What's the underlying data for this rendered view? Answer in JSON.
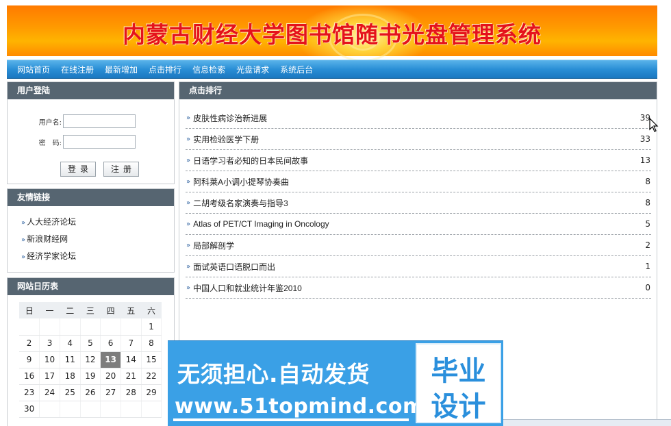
{
  "banner": {
    "title": "内蒙古财经大学图书馆随书光盘管理系统"
  },
  "nav": {
    "items": [
      "网站首页",
      "在线注册",
      "最新增加",
      "点击排行",
      "信息检索",
      "光盘请求",
      "系统后台"
    ]
  },
  "login": {
    "title": "用户登陆",
    "username_label": "用户名:",
    "password_label": "密　码:",
    "username_value": "",
    "password_value": "",
    "login_button": "登录",
    "register_button": "注册"
  },
  "links": {
    "title": "友情链接",
    "items": [
      "人大经济论坛",
      "新浪财经网",
      "经济学家论坛"
    ]
  },
  "calendar": {
    "title": "网站日历表",
    "weekdays": [
      "日",
      "一",
      "二",
      "三",
      "四",
      "五",
      "六"
    ],
    "weeks": [
      [
        "",
        "",
        "",
        "",
        "",
        "",
        "1"
      ],
      [
        "2",
        "3",
        "4",
        "5",
        "6",
        "7",
        "8"
      ],
      [
        "9",
        "10",
        "11",
        "12",
        "13",
        "14",
        "15"
      ],
      [
        "16",
        "17",
        "18",
        "19",
        "20",
        "21",
        "22"
      ],
      [
        "23",
        "24",
        "25",
        "26",
        "27",
        "28",
        "29"
      ],
      [
        "30",
        "",
        "",
        "",
        "",
        "",
        ""
      ]
    ],
    "today": "13"
  },
  "ranking": {
    "title": "点击排行",
    "items": [
      {
        "title": "皮肤性病诊治新进展",
        "count": "39"
      },
      {
        "title": "实用检验医学下册",
        "count": "33"
      },
      {
        "title": "日语学习者必知的日本民间故事",
        "count": "13"
      },
      {
        "title": "阿科莱A小调小提琴协奏曲",
        "count": "8"
      },
      {
        "title": "二胡考级名家演奏与指导3",
        "count": "8"
      },
      {
        "title": "Atlas of PET/CT Imaging in Oncology",
        "count": "5"
      },
      {
        "title": "局部解剖学",
        "count": "2"
      },
      {
        "title": "面试英语口语脱口而出",
        "count": "1"
      },
      {
        "title": "中国人口和就业统计年鉴2010",
        "count": "0"
      }
    ]
  },
  "watermark": {
    "slogan": "无须担心.自动发货",
    "url": "www.51topmind.com",
    "badge_line1": "毕业",
    "badge_line2": "设计"
  },
  "colors": {
    "nav_blue": "#2a8fd6",
    "panel_head": "#566571",
    "banner_orange": "#ff9c00",
    "title_red": "#e5121b",
    "watermark_blue": "#3aa0e6"
  }
}
